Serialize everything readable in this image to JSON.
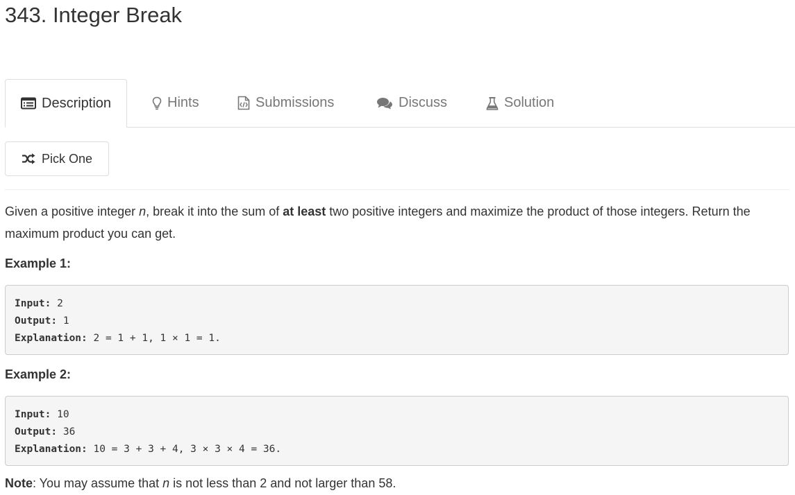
{
  "problem": {
    "title": "343. Integer Break"
  },
  "tabs": [
    {
      "label": "Description",
      "icon": "list-icon",
      "active": true
    },
    {
      "label": "Hints",
      "icon": "lightbulb-icon",
      "active": false
    },
    {
      "label": "Submissions",
      "icon": "code-file-icon",
      "active": false
    },
    {
      "label": "Discuss",
      "icon": "comments-icon",
      "active": false
    },
    {
      "label": "Solution",
      "icon": "flask-icon",
      "active": false
    }
  ],
  "pick_one": {
    "label": "Pick One",
    "icon": "shuffle-icon"
  },
  "description": {
    "part1": "Given a positive integer ",
    "var_n": "n",
    "part2": ", break it into the sum of ",
    "bold": "at least",
    "part3": " two positive integers and maximize the product of those integers. Return the maximum product you can get."
  },
  "examples": [
    {
      "heading": "Example 1:",
      "input_label": "Input:",
      "input_value": " 2",
      "output_label": "Output:",
      "output_value": " 1",
      "explanation_label": "Explanation:",
      "explanation_value": " 2 = 1 + 1, 1 × 1 = 1."
    },
    {
      "heading": "Example 2:",
      "input_label": "Input:",
      "input_value": " 10",
      "output_label": "Output:",
      "output_value": " 36",
      "explanation_label": "Explanation:",
      "explanation_value": " 10 = 3 + 3 + 4, 3 × 3 × 4 = 36."
    }
  ],
  "note": {
    "label": "Note",
    "part1": ": You may assume that ",
    "var_n": "n",
    "part2": " is not less than 2 and not larger than 58."
  },
  "colors": {
    "text": "#333333",
    "muted_tab": "#777777",
    "border": "#dddddd",
    "code_bg": "#f5f5f5"
  }
}
